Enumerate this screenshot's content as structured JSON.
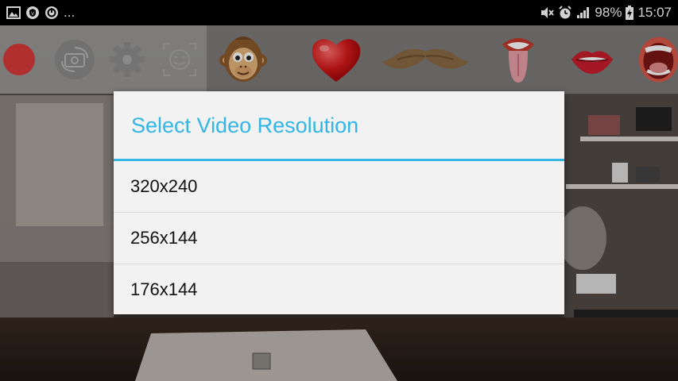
{
  "status_bar": {
    "dots": "...",
    "battery_percent": "98%",
    "time": "15:07"
  },
  "toolbar": {
    "items": [
      {
        "icon": "record-icon"
      },
      {
        "icon": "switch-camera-icon"
      },
      {
        "icon": "gear-icon"
      },
      {
        "icon": "face-detect-icon"
      },
      {
        "icon": "monkey-mask-icon"
      },
      {
        "icon": "heart-sticker-icon"
      },
      {
        "icon": "mustache-sticker-icon"
      },
      {
        "icon": "tongue-sticker-icon"
      },
      {
        "icon": "lips-sticker-icon"
      },
      {
        "icon": "open-mouth-sticker-icon"
      }
    ]
  },
  "dialog": {
    "title": "Select Video Resolution",
    "options": [
      "320x240",
      "256x144",
      "176x144"
    ]
  },
  "colors": {
    "accent": "#33b5e5",
    "record": "#d93a3a"
  }
}
